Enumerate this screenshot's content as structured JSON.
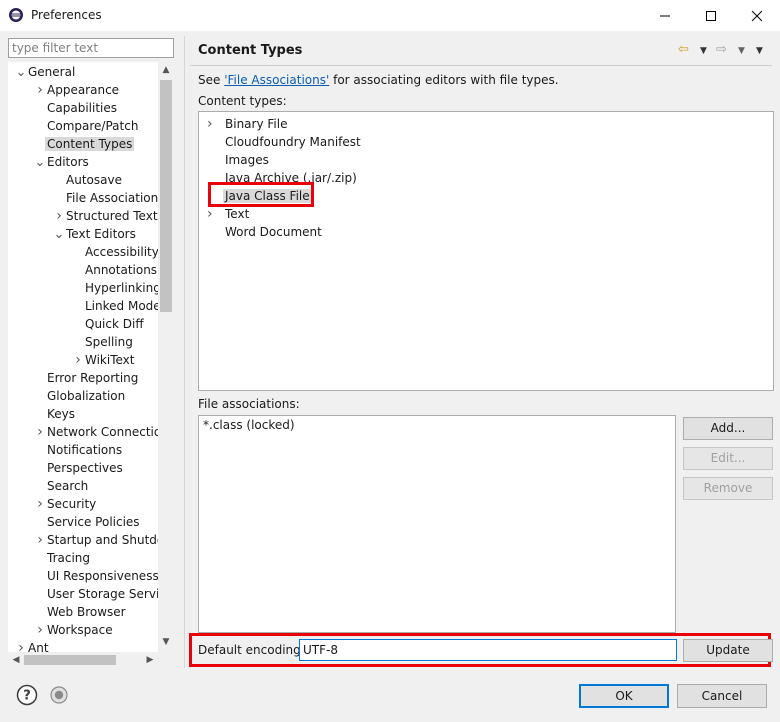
{
  "window": {
    "title": "Preferences"
  },
  "filter": {
    "placeholder": "type filter text"
  },
  "tree": [
    {
      "label": "General",
      "twisty": "down",
      "indent": 0
    },
    {
      "label": "Appearance",
      "twisty": "right",
      "indent": 1
    },
    {
      "label": "Capabilities",
      "twisty": "",
      "indent": 1
    },
    {
      "label": "Compare/Patch",
      "twisty": "",
      "indent": 1
    },
    {
      "label": "Content Types",
      "twisty": "",
      "indent": 1,
      "selected": true
    },
    {
      "label": "Editors",
      "twisty": "down",
      "indent": 1
    },
    {
      "label": "Autosave",
      "twisty": "",
      "indent": 2
    },
    {
      "label": "File Associations",
      "twisty": "",
      "indent": 2
    },
    {
      "label": "Structured Text",
      "twisty": "right",
      "indent": 2
    },
    {
      "label": "Text Editors",
      "twisty": "down",
      "indent": 2
    },
    {
      "label": "Accessibility",
      "twisty": "",
      "indent": 3
    },
    {
      "label": "Annotations",
      "twisty": "",
      "indent": 3
    },
    {
      "label": "Hyperlinking",
      "twisty": "",
      "indent": 3
    },
    {
      "label": "Linked Mode",
      "twisty": "",
      "indent": 3
    },
    {
      "label": "Quick Diff",
      "twisty": "",
      "indent": 3
    },
    {
      "label": "Spelling",
      "twisty": "",
      "indent": 3
    },
    {
      "label": "WikiText",
      "twisty": "right",
      "indent": 3
    },
    {
      "label": "Error Reporting",
      "twisty": "",
      "indent": 1
    },
    {
      "label": "Globalization",
      "twisty": "",
      "indent": 1
    },
    {
      "label": "Keys",
      "twisty": "",
      "indent": 1
    },
    {
      "label": "Network Connection",
      "twisty": "right",
      "indent": 1
    },
    {
      "label": "Notifications",
      "twisty": "",
      "indent": 1
    },
    {
      "label": "Perspectives",
      "twisty": "",
      "indent": 1
    },
    {
      "label": "Search",
      "twisty": "",
      "indent": 1
    },
    {
      "label": "Security",
      "twisty": "right",
      "indent": 1
    },
    {
      "label": "Service Policies",
      "twisty": "",
      "indent": 1
    },
    {
      "label": "Startup and Shutdo",
      "twisty": "right",
      "indent": 1
    },
    {
      "label": "Tracing",
      "twisty": "",
      "indent": 1
    },
    {
      "label": "UI Responsiveness M",
      "twisty": "",
      "indent": 1
    },
    {
      "label": "User Storage Service",
      "twisty": "",
      "indent": 1
    },
    {
      "label": "Web Browser",
      "twisty": "",
      "indent": 1
    },
    {
      "label": "Workspace",
      "twisty": "right",
      "indent": 1
    },
    {
      "label": "Ant",
      "twisty": "right",
      "indent": 0
    }
  ],
  "page": {
    "title": "Content Types",
    "see_prefix": "See ",
    "see_link": "'File Associations'",
    "see_suffix": " for associating editors with file types.",
    "content_types_label": "Content types:",
    "content_types": [
      {
        "label": "Binary File",
        "twisty": "right"
      },
      {
        "label": "Cloudfoundry Manifest",
        "twisty": ""
      },
      {
        "label": "Images",
        "twisty": ""
      },
      {
        "label": "Java Archive (.jar/.zip)",
        "twisty": ""
      },
      {
        "label": "Java Class File",
        "twisty": "",
        "selected": true
      },
      {
        "label": "Text",
        "twisty": "right"
      },
      {
        "label": "Word Document",
        "twisty": ""
      }
    ],
    "file_assoc_label": "File associations:",
    "file_assoc": [
      "*.class (locked)"
    ],
    "buttons": {
      "add": "Add...",
      "edit": "Edit...",
      "remove": "Remove"
    },
    "encoding_label": "Default encoding:",
    "encoding_value": "UTF-8",
    "update": "Update"
  },
  "footer": {
    "ok": "OK",
    "cancel": "Cancel"
  },
  "colors": {
    "highlight": "#e8000b",
    "link": "#0b5cad",
    "selection": "#d9d9d9"
  }
}
